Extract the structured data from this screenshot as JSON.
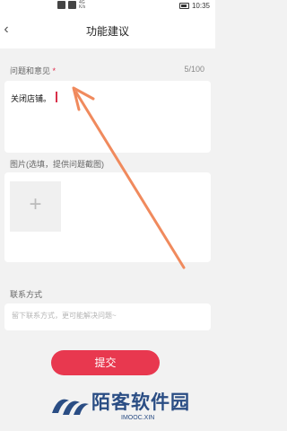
{
  "status_bar": {
    "network": "4G",
    "network_speed": "K/s",
    "time": "10:35"
  },
  "header": {
    "title": "功能建议"
  },
  "feedback": {
    "label": "问题和意见",
    "required_mark": "*",
    "counter": "5/100",
    "value": "关闭店铺。"
  },
  "images": {
    "label": "图片(选填，提供问题截图)"
  },
  "contact": {
    "label": "联系方式",
    "placeholder": "留下联系方式，更可能解决问题~"
  },
  "submit_label": "提交",
  "watermark": {
    "brand": "陌客软件园",
    "url": "IMOOC.XIN"
  },
  "colors": {
    "accent": "#e8384f",
    "arrow": "#f08a5d",
    "watermark": "#2a4d84"
  }
}
